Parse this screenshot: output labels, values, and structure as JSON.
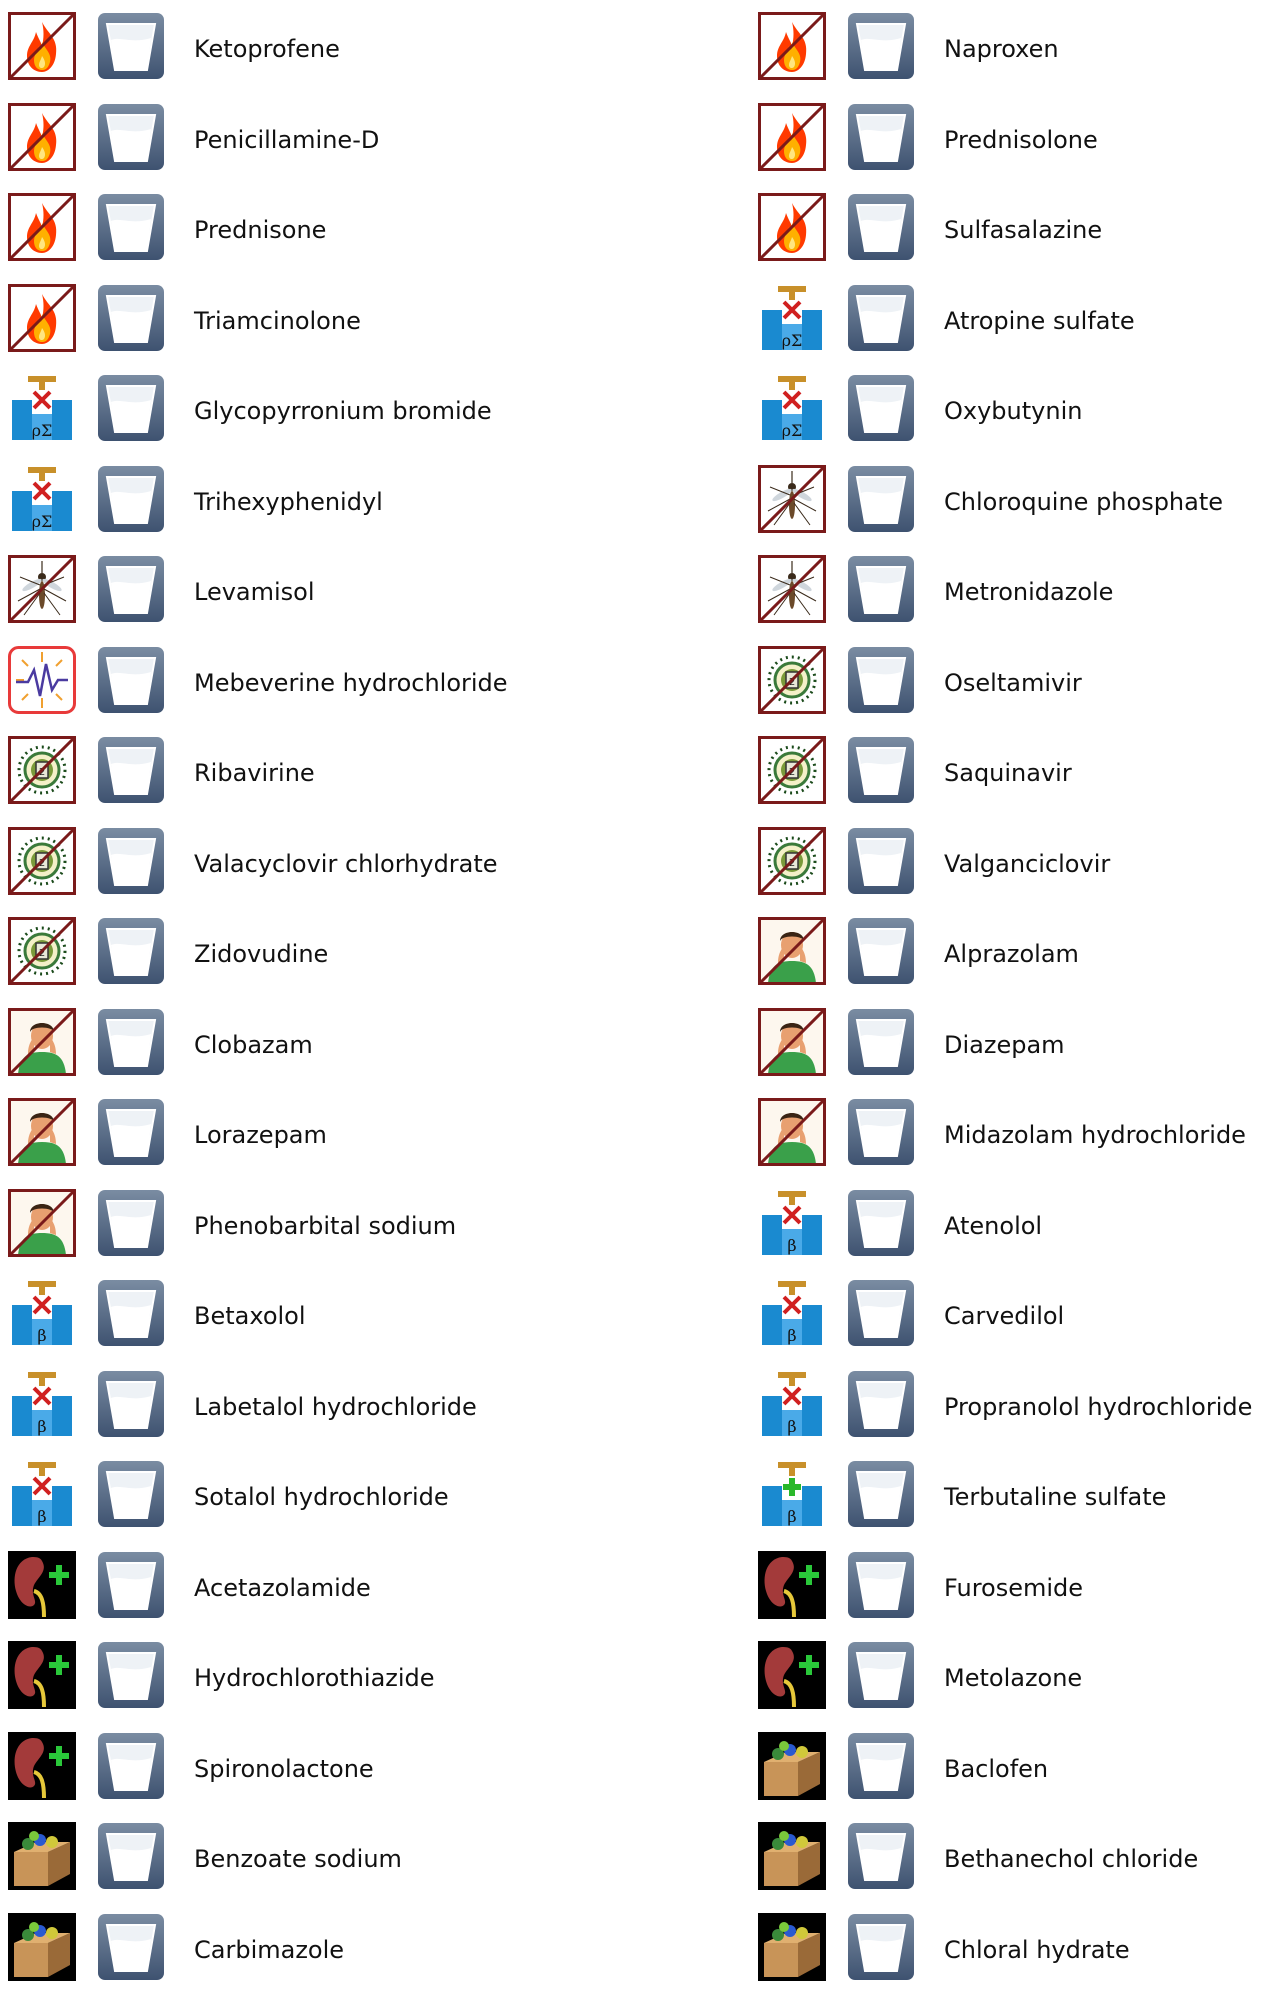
{
  "drugs": [
    {
      "name": "Ketoprofene",
      "category_icon": "fire-icon"
    },
    {
      "name": "Naproxen",
      "category_icon": "fire-icon"
    },
    {
      "name": "Penicillamine-D",
      "category_icon": "fire-icon"
    },
    {
      "name": "Prednisolone",
      "category_icon": "fire-icon"
    },
    {
      "name": "Prednisone",
      "category_icon": "fire-icon"
    },
    {
      "name": "Sulfasalazine",
      "category_icon": "fire-icon"
    },
    {
      "name": "Triamcinolone",
      "category_icon": "fire-icon"
    },
    {
      "name": "Atropine sulfate",
      "category_icon": "valve-rho-sigma-icon"
    },
    {
      "name": "Glycopyrronium bromide",
      "category_icon": "valve-rho-sigma-icon"
    },
    {
      "name": "Oxybutynin",
      "category_icon": "valve-rho-sigma-icon"
    },
    {
      "name": "Trihexyphenidyl",
      "category_icon": "valve-rho-sigma-icon"
    },
    {
      "name": "Chloroquine phosphate",
      "category_icon": "mosquito-icon"
    },
    {
      "name": "Levamisol",
      "category_icon": "mosquito-icon"
    },
    {
      "name": "Metronidazole",
      "category_icon": "mosquito-icon"
    },
    {
      "name": "Mebeverine hydrochloride",
      "category_icon": "spasm-icon"
    },
    {
      "name": "Oseltamivir",
      "category_icon": "virus-icon"
    },
    {
      "name": "Ribavirine",
      "category_icon": "virus-icon"
    },
    {
      "name": "Saquinavir",
      "category_icon": "virus-icon"
    },
    {
      "name": "Valacyclovir chlorhydrate",
      "category_icon": "virus-icon"
    },
    {
      "name": "Valganciclovir",
      "category_icon": "virus-icon"
    },
    {
      "name": "Zidovudine",
      "category_icon": "virus-icon"
    },
    {
      "name": "Alprazolam",
      "category_icon": "anxious-person-icon"
    },
    {
      "name": "Clobazam",
      "category_icon": "anxious-person-icon"
    },
    {
      "name": "Diazepam",
      "category_icon": "anxious-person-icon"
    },
    {
      "name": "Lorazepam",
      "category_icon": "anxious-person-icon"
    },
    {
      "name": "Midazolam hydrochloride",
      "category_icon": "anxious-person-icon"
    },
    {
      "name": "Phenobarbital sodium",
      "category_icon": "anxious-person-icon"
    },
    {
      "name": "Atenolol",
      "category_icon": "valve-beta-block-icon"
    },
    {
      "name": "Betaxolol",
      "category_icon": "valve-beta-block-icon"
    },
    {
      "name": "Carvedilol",
      "category_icon": "valve-beta-block-icon"
    },
    {
      "name": "Labetalol hydrochloride",
      "category_icon": "valve-beta-block-icon"
    },
    {
      "name": "Propranolol hydrochloride",
      "category_icon": "valve-beta-block-icon"
    },
    {
      "name": "Sotalol hydrochloride",
      "category_icon": "valve-beta-block-icon"
    },
    {
      "name": "Terbutaline sulfate",
      "category_icon": "valve-beta-plus-icon"
    },
    {
      "name": "Acetazolamide",
      "category_icon": "kidney-icon"
    },
    {
      "name": "Furosemide",
      "category_icon": "kidney-icon"
    },
    {
      "name": "Hydrochlorothiazide",
      "category_icon": "kidney-icon"
    },
    {
      "name": "Metolazone",
      "category_icon": "kidney-icon"
    },
    {
      "name": "Spironolactone",
      "category_icon": "kidney-icon"
    },
    {
      "name": "Baclofen",
      "category_icon": "toolbox-icon"
    },
    {
      "name": "Benzoate sodium",
      "category_icon": "toolbox-icon"
    },
    {
      "name": "Bethanechol chloride",
      "category_icon": "toolbox-icon"
    },
    {
      "name": "Carbimazole",
      "category_icon": "toolbox-icon"
    },
    {
      "name": "Chloral hydrate",
      "category_icon": "toolbox-icon"
    }
  ],
  "glass_icon": "water-glass-icon"
}
